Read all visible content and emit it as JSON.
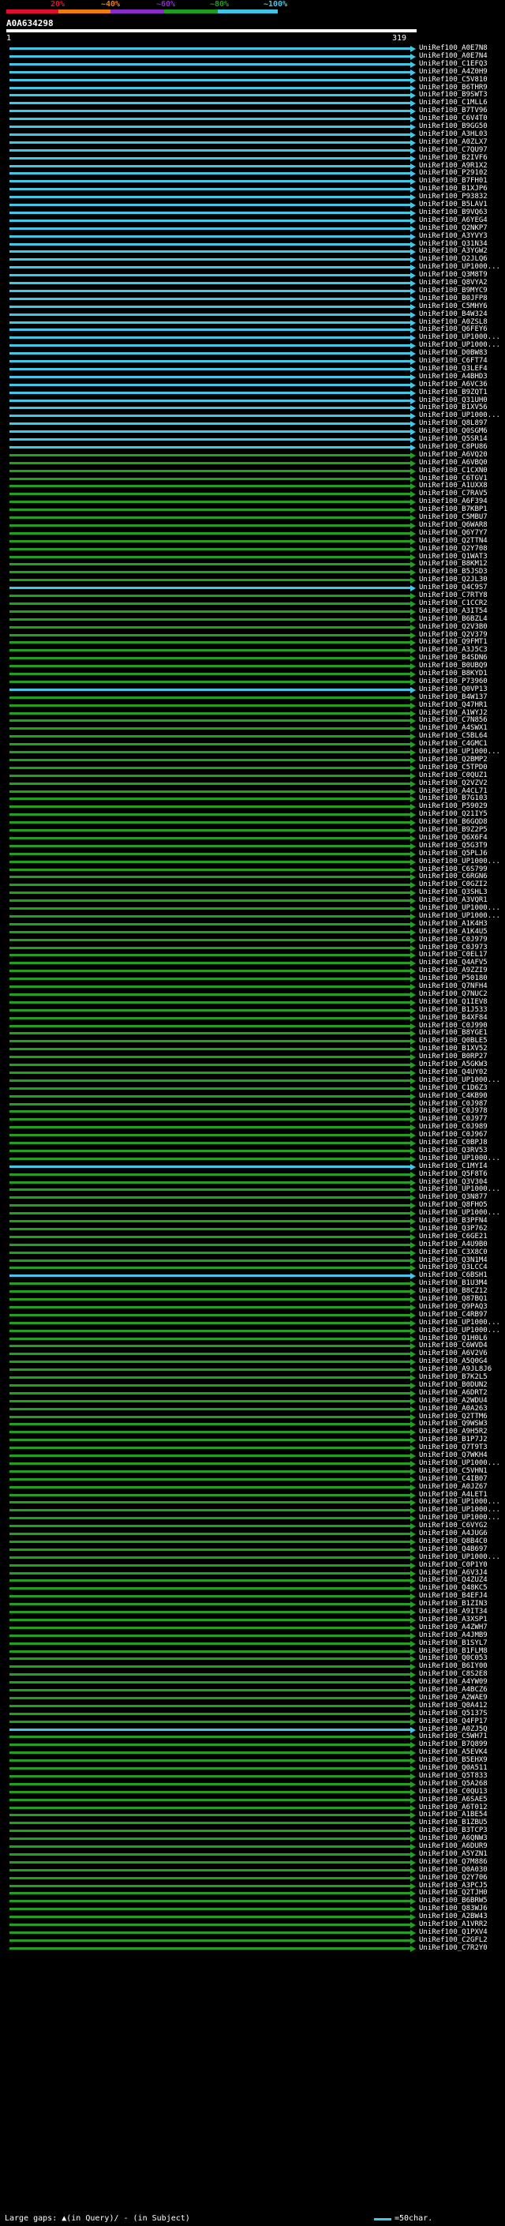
{
  "scale": {
    "labels": [
      "20%",
      "~40%",
      "~60%",
      "~80%",
      "~100%"
    ],
    "colors": [
      "#e0102c",
      "#ee7b0c",
      "#8a2cc8",
      "#1f9c1f",
      "#3ec6e8"
    ]
  },
  "query": {
    "id": "A0A634298",
    "start": "1",
    "end": "319"
  },
  "colors": {
    "cyan": "#41c8e8",
    "green": "#24a020",
    "gap": "#ffff00"
  },
  "hits": [
    {
      "name": "UniRef100_A0E7N8",
      "c": "cyan"
    },
    {
      "name": "UniRef100_A0E7N4",
      "c": "cyan"
    },
    {
      "name": "UniRef100_C1EFQ3",
      "c": "cyan"
    },
    {
      "name": "UniRef100_A4Z0H9",
      "c": "cyan"
    },
    {
      "name": "UniRef100_C5V810",
      "c": "cyan"
    },
    {
      "name": "UniRef100_B6THR9",
      "c": "cyan"
    },
    {
      "name": "UniRef100_B9SWT3",
      "c": "cyan"
    },
    {
      "name": "UniRef100_C1MLL6",
      "c": "cyan"
    },
    {
      "name": "UniRef100_B7TV96",
      "c": "cyan"
    },
    {
      "name": "UniRef100_C6V4T0",
      "c": "cyan"
    },
    {
      "name": "UniRef100_B9GG50",
      "c": "cyan"
    },
    {
      "name": "UniRef100_A3HL03",
      "c": "cyan"
    },
    {
      "name": "UniRef100_A0ZLX7",
      "c": "cyan"
    },
    {
      "name": "UniRef100_C7QU97",
      "c": "cyan"
    },
    {
      "name": "UniRef100_B2IVF6",
      "c": "cyan"
    },
    {
      "name": "UniRef100_A9R1X2",
      "c": "cyan"
    },
    {
      "name": "UniRef100_P29102",
      "c": "cyan"
    },
    {
      "name": "UniRef100_B7FH01",
      "c": "cyan"
    },
    {
      "name": "UniRef100_B1XJP6",
      "c": "cyan"
    },
    {
      "name": "UniRef100_P93832",
      "c": "cyan"
    },
    {
      "name": "UniRef100_B5LAV1",
      "c": "cyan"
    },
    {
      "name": "UniRef100_B9VQ63",
      "c": "cyan"
    },
    {
      "name": "UniRef100_A6YEG4",
      "c": "cyan"
    },
    {
      "name": "UniRef100_Q2NKP7",
      "c": "cyan"
    },
    {
      "name": "UniRef100_A3YVY3",
      "c": "cyan"
    },
    {
      "name": "UniRef100_Q31N34",
      "c": "cyan"
    },
    {
      "name": "UniRef100_A3YGW2",
      "c": "cyan"
    },
    {
      "name": "UniRef100_Q2JLQ6",
      "c": "cyan"
    },
    {
      "name": "UniRef100_UP1000...",
      "c": "cyan"
    },
    {
      "name": "UniRef100_Q3M8T9",
      "c": "cyan"
    },
    {
      "name": "UniRef100_Q8VYA2",
      "c": "cyan"
    },
    {
      "name": "UniRef100_B9MYC9",
      "c": "cyan"
    },
    {
      "name": "UniRef100_B0JFP8",
      "c": "cyan"
    },
    {
      "name": "UniRef100_C5MHY6",
      "c": "cyan"
    },
    {
      "name": "UniRef100_B4W324",
      "c": "cyan"
    },
    {
      "name": "UniRef100_A0ZSL8",
      "c": "cyan"
    },
    {
      "name": "UniRef100_Q6FEY6",
      "c": "cyan"
    },
    {
      "name": "UniRef100_UP1000...",
      "c": "cyan"
    },
    {
      "name": "UniRef100_UP1000...",
      "c": "cyan"
    },
    {
      "name": "UniRef100_D0BW83",
      "c": "cyan"
    },
    {
      "name": "UniRef100_C6FT74",
      "c": "cyan"
    },
    {
      "name": "UniRef100_Q3LEF4",
      "c": "cyan"
    },
    {
      "name": "UniRef100_A4BHD3",
      "c": "cyan"
    },
    {
      "name": "UniRef100_A6VC36",
      "c": "cyan"
    },
    {
      "name": "UniRef100_B9ZQT1",
      "c": "cyan"
    },
    {
      "name": "UniRef100_Q31UH0",
      "c": "cyan"
    },
    {
      "name": "UniRef100_B1XV56",
      "c": "cyan"
    },
    {
      "name": "UniRef100_UP1000...",
      "c": "cyan"
    },
    {
      "name": "UniRef100_Q8L897",
      "c": "cyan"
    },
    {
      "name": "UniRef100_Q0SGM6",
      "c": "cyan"
    },
    {
      "name": "UniRef100_Q5SR14",
      "c": "cyan"
    },
    {
      "name": "UniRef100_C8PU86",
      "c": "cyan"
    },
    {
      "name": "UniRef100_A6VQ20",
      "c": "green"
    },
    {
      "name": "UniRef100_A6VBQ0",
      "c": "green"
    },
    {
      "name": "UniRef100_C1CXN0",
      "c": "green"
    },
    {
      "name": "UniRef100_C6TGV1",
      "c": "green"
    },
    {
      "name": "UniRef100_A1UXX8",
      "c": "green"
    },
    {
      "name": "UniRef100_C7RAV5",
      "c": "green"
    },
    {
      "name": "UniRef100_A6F394",
      "c": "green"
    },
    {
      "name": "UniRef100_B7KBP1",
      "c": "green"
    },
    {
      "name": "UniRef100_C5MBU7",
      "c": "green"
    },
    {
      "name": "UniRef100_Q6WAR8",
      "c": "green"
    },
    {
      "name": "UniRef100_Q6Y7Y7",
      "c": "green"
    },
    {
      "name": "UniRef100_Q2TTN4",
      "c": "green"
    },
    {
      "name": "UniRef100_Q2Y708",
      "c": "green"
    },
    {
      "name": "UniRef100_Q1WAT3",
      "c": "green"
    },
    {
      "name": "UniRef100_B8KM12",
      "c": "green"
    },
    {
      "name": "UniRef100_B5JSD3",
      "c": "green"
    },
    {
      "name": "UniRef100_Q2JL30",
      "c": "green"
    },
    {
      "name": "UniRef100_Q4C9S7",
      "c": "cyan"
    },
    {
      "name": "UniRef100_C7RTY8",
      "c": "green"
    },
    {
      "name": "UniRef100_C1CCR2",
      "c": "green"
    },
    {
      "name": "UniRef100_A3IT54",
      "c": "green"
    },
    {
      "name": "UniRef100_B6BZL4",
      "c": "green"
    },
    {
      "name": "UniRef100_Q2V3B0",
      "c": "green"
    },
    {
      "name": "UniRef100_Q2V379",
      "c": "green"
    },
    {
      "name": "UniRef100_Q9FMT1",
      "c": "green"
    },
    {
      "name": "UniRef100_A3J5C3",
      "c": "green"
    },
    {
      "name": "UniRef100_B4SDN6",
      "c": "green"
    },
    {
      "name": "UniRef100_B0UBQ9",
      "c": "green"
    },
    {
      "name": "UniRef100_B8KYD1",
      "c": "green"
    },
    {
      "name": "UniRef100_P73960",
      "c": "green"
    },
    {
      "name": "UniRef100_Q0VP13",
      "c": "cyan"
    },
    {
      "name": "UniRef100_B4W137",
      "c": "green"
    },
    {
      "name": "UniRef100_Q47HR1",
      "c": "green"
    },
    {
      "name": "UniRef100_A1WYJ2",
      "c": "green"
    },
    {
      "name": "UniRef100_C7N856",
      "c": "green"
    },
    {
      "name": "UniRef100_A4SWX1",
      "c": "green"
    },
    {
      "name": "UniRef100_C5BL64",
      "c": "green"
    },
    {
      "name": "UniRef100_C4GMC1",
      "c": "green"
    },
    {
      "name": "UniRef100_UP1000...",
      "c": "green"
    },
    {
      "name": "UniRef100_Q2BMP2",
      "c": "green"
    },
    {
      "name": "UniRef100_C5TPD0",
      "c": "green"
    },
    {
      "name": "UniRef100_C0QUZ1",
      "c": "green"
    },
    {
      "name": "UniRef100_Q2VZV2",
      "c": "green"
    },
    {
      "name": "UniRef100_A4CL71",
      "c": "green"
    },
    {
      "name": "UniRef100_B7G103",
      "c": "green"
    },
    {
      "name": "UniRef100_P59029",
      "c": "green"
    },
    {
      "name": "UniRef100_Q21IY5",
      "c": "green"
    },
    {
      "name": "UniRef100_B6GQD8",
      "c": "green"
    },
    {
      "name": "UniRef100_B9Z2P5",
      "c": "green"
    },
    {
      "name": "UniRef100_Q6X6F4",
      "c": "green"
    },
    {
      "name": "UniRef100_Q5G3T9",
      "c": "green"
    },
    {
      "name": "UniRef100_Q5PLJ6",
      "c": "green"
    },
    {
      "name": "UniRef100_UP1000...",
      "c": "green"
    },
    {
      "name": "UniRef100_C6S799",
      "c": "green"
    },
    {
      "name": "UniRef100_C6RGN6",
      "c": "green"
    },
    {
      "name": "UniRef100_C0GZI2",
      "c": "green"
    },
    {
      "name": "UniRef100_Q3SHL3",
      "c": "green"
    },
    {
      "name": "UniRef100_A3VQR1",
      "c": "green"
    },
    {
      "name": "UniRef100_UP1000...",
      "c": "green"
    },
    {
      "name": "UniRef100_UP1000...",
      "c": "green"
    },
    {
      "name": "UniRef100_A1K4H3",
      "c": "green"
    },
    {
      "name": "UniRef100_A1K4U5",
      "c": "green"
    },
    {
      "name": "UniRef100_C0J979",
      "c": "green"
    },
    {
      "name": "UniRef100_C0J973",
      "c": "green"
    },
    {
      "name": "UniRef100_C0EL17",
      "c": "green"
    },
    {
      "name": "UniRef100_Q4AFV5",
      "c": "green"
    },
    {
      "name": "UniRef100_A9ZZI9",
      "c": "green"
    },
    {
      "name": "UniRef100_P50180",
      "c": "green"
    },
    {
      "name": "UniRef100_Q7NFH4",
      "c": "green"
    },
    {
      "name": "UniRef100_Q7NUC2",
      "c": "green"
    },
    {
      "name": "UniRef100_Q1IEV8",
      "c": "green"
    },
    {
      "name": "UniRef100_B1J533",
      "c": "green"
    },
    {
      "name": "UniRef100_B4XF84",
      "c": "green"
    },
    {
      "name": "UniRef100_C0J990",
      "c": "green"
    },
    {
      "name": "UniRef100_B8YGE1",
      "c": "green"
    },
    {
      "name": "UniRef100_Q0BLE5",
      "c": "green"
    },
    {
      "name": "UniRef100_B1XV52",
      "c": "green"
    },
    {
      "name": "UniRef100_B0RP27",
      "c": "green"
    },
    {
      "name": "UniRef100_A5GKW3",
      "c": "green"
    },
    {
      "name": "UniRef100_Q4UY02",
      "c": "green"
    },
    {
      "name": "UniRef100_UP1000...",
      "c": "green"
    },
    {
      "name": "UniRef100_C1D6Z3",
      "c": "green"
    },
    {
      "name": "UniRef100_C4KB90",
      "c": "green"
    },
    {
      "name": "UniRef100_C0J987",
      "c": "green"
    },
    {
      "name": "UniRef100_C0J978",
      "c": "green"
    },
    {
      "name": "UniRef100_C0J977",
      "c": "green"
    },
    {
      "name": "UniRef100_C0J989",
      "c": "green"
    },
    {
      "name": "UniRef100_C0J967",
      "c": "green"
    },
    {
      "name": "UniRef100_C0BPJ8",
      "c": "green"
    },
    {
      "name": "UniRef100_Q3RV53",
      "c": "green"
    },
    {
      "name": "UniRef100_UP1000...",
      "c": "green"
    },
    {
      "name": "UniRef100_C1MYI4",
      "c": "cyan"
    },
    {
      "name": "UniRef100_Q5F8T6",
      "c": "green"
    },
    {
      "name": "UniRef100_Q3V304",
      "c": "green"
    },
    {
      "name": "UniRef100_UP1000...",
      "c": "green"
    },
    {
      "name": "UniRef100_Q3N877",
      "c": "green"
    },
    {
      "name": "UniRef100_Q8FHO5",
      "c": "green"
    },
    {
      "name": "UniRef100_UP1000...",
      "c": "green"
    },
    {
      "name": "UniRef100_B3PFN4",
      "c": "green"
    },
    {
      "name": "UniRef100_Q3P762",
      "c": "green"
    },
    {
      "name": "UniRef100_C6GE21",
      "c": "green"
    },
    {
      "name": "UniRef100_A4U9B0",
      "c": "green"
    },
    {
      "name": "UniRef100_C3X8C0",
      "c": "green"
    },
    {
      "name": "UniRef100_Q3N1M4",
      "c": "green"
    },
    {
      "name": "UniRef100_Q3LCC4",
      "c": "green"
    },
    {
      "name": "UniRef100_C6BSH1",
      "c": "cyan"
    },
    {
      "name": "UniRef100_B1U3M4",
      "c": "green"
    },
    {
      "name": "UniRef100_B8CZ12",
      "c": "green"
    },
    {
      "name": "UniRef100_Q87BQ1",
      "c": "green"
    },
    {
      "name": "UniRef100_Q9PAQ3",
      "c": "green"
    },
    {
      "name": "UniRef100_C4RB97",
      "c": "green"
    },
    {
      "name": "UniRef100_UP1000...",
      "c": "green"
    },
    {
      "name": "UniRef100_UP1000...",
      "c": "green"
    },
    {
      "name": "UniRef100_Q1H0L6",
      "c": "green"
    },
    {
      "name": "UniRef100_C6WVD4",
      "c": "green"
    },
    {
      "name": "UniRef100_A6V2V6",
      "c": "green"
    },
    {
      "name": "UniRef100_A5Q0G4",
      "c": "green"
    },
    {
      "name": "UniRef100_A9JL8J6",
      "c": "green"
    },
    {
      "name": "UniRef100_B7K2L5",
      "c": "green"
    },
    {
      "name": "UniRef100_B0DUN2",
      "c": "green"
    },
    {
      "name": "UniRef100_A6DRT2",
      "c": "green"
    },
    {
      "name": "UniRef100_A2WDU4",
      "c": "green"
    },
    {
      "name": "UniRef100_A0A263",
      "c": "green"
    },
    {
      "name": "UniRef100_Q2TTM6",
      "c": "green"
    },
    {
      "name": "UniRef100_Q9WSW3",
      "c": "green"
    },
    {
      "name": "UniRef100_A9H5R2",
      "c": "green"
    },
    {
      "name": "UniRef100_B1P7J2",
      "c": "green"
    },
    {
      "name": "UniRef100_Q7T9T3",
      "c": "green"
    },
    {
      "name": "UniRef100_Q7WKH4",
      "c": "green"
    },
    {
      "name": "UniRef100_UP1000...",
      "c": "green"
    },
    {
      "name": "UniRef100_C5VHN1",
      "c": "green"
    },
    {
      "name": "UniRef100_C4IB07",
      "c": "green"
    },
    {
      "name": "UniRef100_A0JZ67",
      "c": "green"
    },
    {
      "name": "UniRef100_A4LET1",
      "c": "green"
    },
    {
      "name": "UniRef100_UP1000...",
      "c": "green"
    },
    {
      "name": "UniRef100_UP1000...",
      "c": "green"
    },
    {
      "name": "UniRef100_UP1000...",
      "c": "green"
    },
    {
      "name": "UniRef100_C6VYG2",
      "c": "green"
    },
    {
      "name": "UniRef100_A4JUG6",
      "c": "green"
    },
    {
      "name": "UniRef100_Q8B4C0",
      "c": "green"
    },
    {
      "name": "UniRef100_Q4B697",
      "c": "green"
    },
    {
      "name": "UniRef100_UP1000...",
      "c": "green"
    },
    {
      "name": "UniRef100_C0P1Y0",
      "c": "green"
    },
    {
      "name": "UniRef100_A6V3J4",
      "c": "green"
    },
    {
      "name": "UniRef100_Q4ZUZ4",
      "c": "green"
    },
    {
      "name": "UniRef100_Q48KC5",
      "c": "green"
    },
    {
      "name": "UniRef100_B4EFJ4",
      "c": "green"
    },
    {
      "name": "UniRef100_B1ZIN3",
      "c": "green"
    },
    {
      "name": "UniRef100_A9IT34",
      "c": "green"
    },
    {
      "name": "UniRef100_A3XSP1",
      "c": "green"
    },
    {
      "name": "UniRef100_A4ZWH7",
      "c": "green"
    },
    {
      "name": "UniRef100_A4JMB9",
      "c": "green"
    },
    {
      "name": "UniRef100_B1SYL7",
      "c": "green"
    },
    {
      "name": "UniRef100_B1FLM8",
      "c": "green"
    },
    {
      "name": "UniRef100_Q0C053",
      "c": "green"
    },
    {
      "name": "UniRef100_B6IY00",
      "c": "green"
    },
    {
      "name": "UniRef100_C8S2E8",
      "c": "green"
    },
    {
      "name": "UniRef100_A4YW09",
      "c": "green"
    },
    {
      "name": "UniRef100_A4BCZ6",
      "c": "green"
    },
    {
      "name": "UniRef100_A2WAE9",
      "c": "green"
    },
    {
      "name": "UniRef100_Q0A412",
      "c": "green"
    },
    {
      "name": "UniRef100_Q5137S",
      "c": "green"
    },
    {
      "name": "UniRef100_Q4FP17",
      "c": "green"
    },
    {
      "name": "UniRef100_A0ZJ5Q",
      "c": "cyan"
    },
    {
      "name": "UniRef100_C5WH71",
      "c": "green"
    },
    {
      "name": "UniRef100_B7Q899",
      "c": "green"
    },
    {
      "name": "UniRef100_A5EVK4",
      "c": "green"
    },
    {
      "name": "UniRef100_B5EHX9",
      "c": "green"
    },
    {
      "name": "UniRef100_Q0A511",
      "c": "green"
    },
    {
      "name": "UniRef100_Q5T833",
      "c": "green"
    },
    {
      "name": "UniRef100_Q5A268",
      "c": "green"
    },
    {
      "name": "UniRef100_C0QU13",
      "c": "green"
    },
    {
      "name": "UniRef100_A6SAE5",
      "c": "green"
    },
    {
      "name": "UniRef100_A6T012",
      "c": "green"
    },
    {
      "name": "UniRef100_A1BE54",
      "c": "green"
    },
    {
      "name": "UniRef100_B1ZBU5",
      "c": "green"
    },
    {
      "name": "UniRef100_B3TCP3",
      "c": "green"
    },
    {
      "name": "UniRef100_A6QNW3",
      "c": "green"
    },
    {
      "name": "UniRef100_A6DUR9",
      "c": "green"
    },
    {
      "name": "UniRef100_A5YZN1",
      "c": "green"
    },
    {
      "name": "UniRef100_Q7M886",
      "c": "green"
    },
    {
      "name": "UniRef100_Q0A030",
      "c": "green"
    },
    {
      "name": "UniRef100_Q2Y706",
      "c": "green"
    },
    {
      "name": "UniRef100_A3PCJ5",
      "c": "green"
    },
    {
      "name": "UniRef100_Q2TJH0",
      "c": "green"
    },
    {
      "name": "UniRef100_B6BRW5",
      "c": "green"
    },
    {
      "name": "UniRef100_Q83WJ6",
      "c": "green"
    },
    {
      "name": "UniRef100_A2BW43",
      "c": "green"
    },
    {
      "name": "UniRef100_A1VRR2",
      "c": "green"
    },
    {
      "name": "UniRef100_Q1PXV4",
      "c": "green"
    },
    {
      "name": "UniRef100_C2GFL2",
      "c": "green"
    },
    {
      "name": "UniRef100_C7R2Y0",
      "c": "green"
    }
  ],
  "legend": {
    "large_gaps": "Large gaps: ▲(in Query)/ - (in Subject)",
    "scale_text": "=50char."
  }
}
